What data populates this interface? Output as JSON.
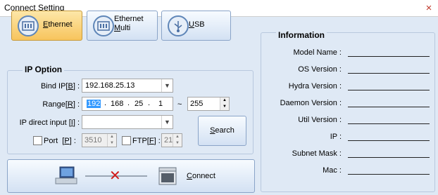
{
  "window": {
    "title": "Connect Setting",
    "close": "×"
  },
  "tabs": [
    {
      "id": "ethernet",
      "label": "Ethernet",
      "underline_char": "E",
      "active": true
    },
    {
      "id": "ethernet-multi",
      "label1": "Ethernet",
      "label2": "Multi",
      "underline_char": "M",
      "active": false
    },
    {
      "id": "usb",
      "label": "USB",
      "underline_char": "U",
      "active": false
    }
  ],
  "ip_option": {
    "title": "IP Option",
    "bind_ip": {
      "label": "Bind IP",
      "hotkey": "B",
      "value": "192.168.25.13"
    },
    "range": {
      "label": "Range",
      "hotkey": "R",
      "octets": [
        "192",
        "168",
        "25",
        "1"
      ],
      "tilde": "~",
      "end": "255"
    },
    "ip_direct": {
      "label": "IP direct input",
      "hotkey": "I",
      "value": ""
    },
    "port": {
      "label": "Port",
      "hotkey": "P",
      "value": "3510",
      "checked": false
    },
    "ftp": {
      "label": "FTP",
      "hotkey": "F",
      "value": "21",
      "checked": false
    },
    "search": {
      "label": "Search",
      "underline_char": "S"
    }
  },
  "connect": {
    "label": "Connect",
    "underline_char": "C"
  },
  "information": {
    "title": "Information",
    "fields": [
      {
        "label": "Model Name :"
      },
      {
        "label": "OS Version :"
      },
      {
        "label": "Hydra Version :"
      },
      {
        "label": "Daemon Version :"
      },
      {
        "label": "Util Version :"
      },
      {
        "label": "IP :"
      },
      {
        "label": "Subnet Mask :"
      },
      {
        "label": "Mac :"
      }
    ]
  },
  "colors": {
    "background": "#dfe9f5",
    "active_tab": "#f7c45d",
    "button_border": "#8aa4c8",
    "close": "#c0392b",
    "disconnect_x": "#d11a1a"
  }
}
